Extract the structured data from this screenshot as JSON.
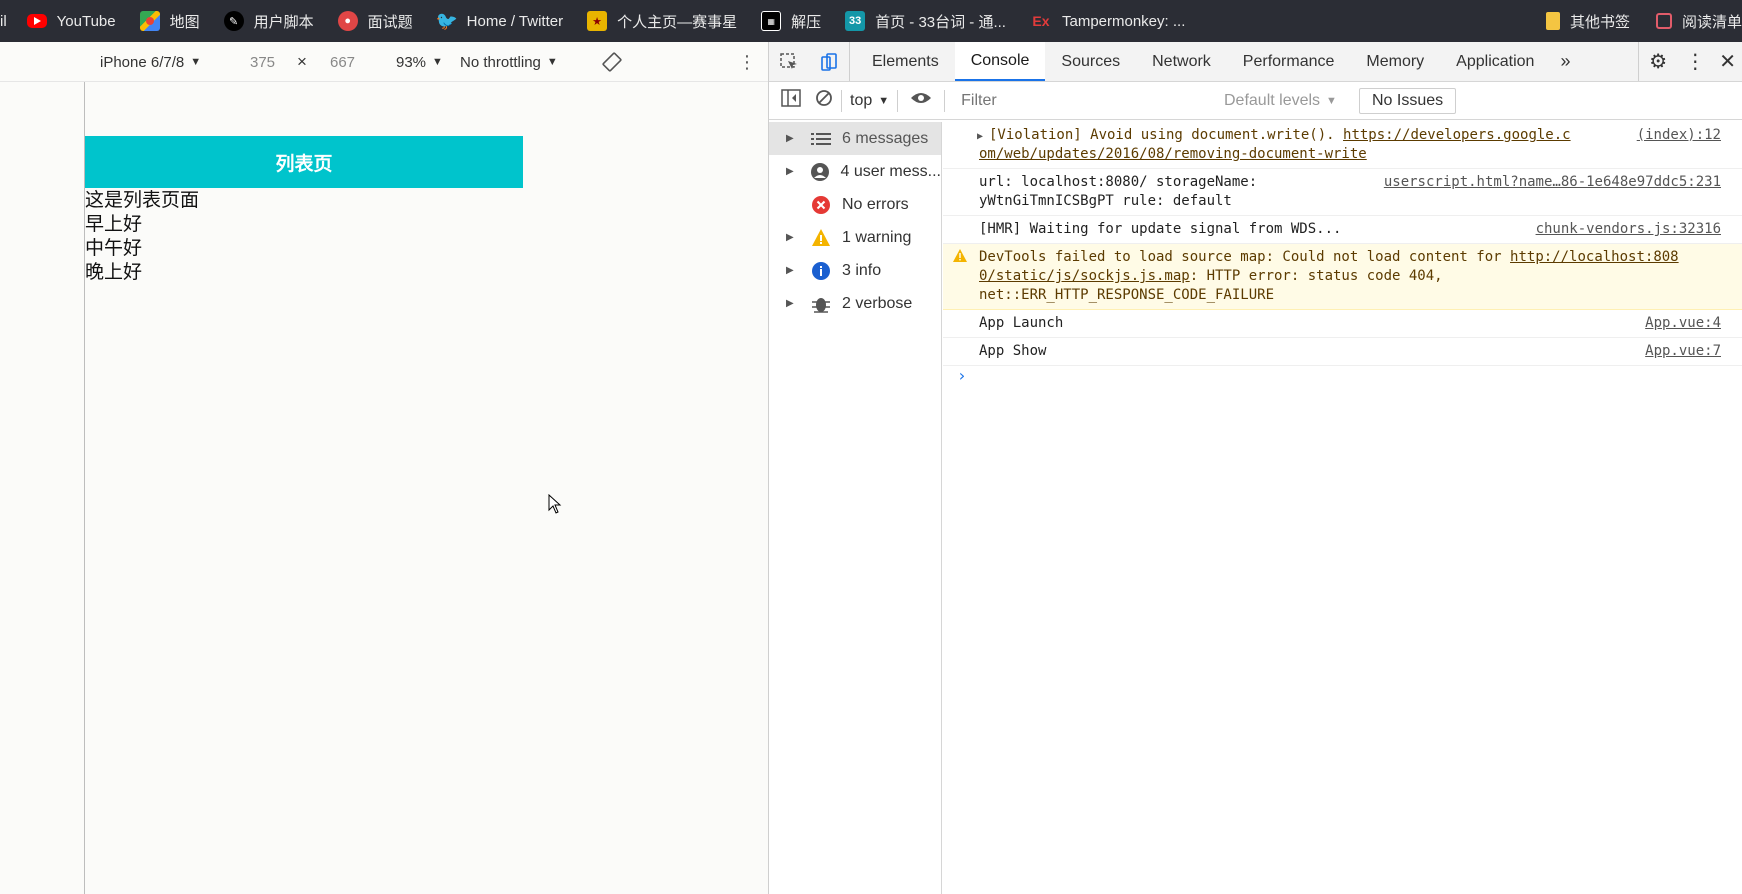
{
  "bookmarks": {
    "items": [
      {
        "label": "il"
      },
      {
        "label": "YouTube"
      },
      {
        "label": "地图"
      },
      {
        "label": "用户脚本"
      },
      {
        "label": "面试题"
      },
      {
        "label": "Home / Twitter"
      },
      {
        "label": "个人主页—赛事星"
      },
      {
        "label": "解压"
      },
      {
        "label": "首页 - 33台词 - 通..."
      },
      {
        "label": "Tampermonkey: ..."
      }
    ],
    "other": "其他书签",
    "reading_list": "阅读清单"
  },
  "device_toolbar": {
    "device": "iPhone 6/7/8",
    "width": "375",
    "times": "×",
    "height": "667",
    "zoom": "93%",
    "throttling": "No throttling"
  },
  "page": {
    "title": "列表页",
    "lines": [
      "这是列表页面",
      "早上好",
      "中午好",
      "晚上好"
    ]
  },
  "devtools": {
    "tabs": [
      "Elements",
      "Console",
      "Sources",
      "Network",
      "Performance",
      "Memory",
      "Application"
    ],
    "active_tab": "Console",
    "context": "top",
    "filter_placeholder": "Filter",
    "levels": "Default levels",
    "issues": "No Issues",
    "sidebar": [
      {
        "label": "6 messages",
        "icon": "list-icon"
      },
      {
        "label": "4 user mess...",
        "icon": "user-icon"
      },
      {
        "label": "No errors",
        "icon": "error-icon"
      },
      {
        "label": "1 warning",
        "icon": "warning-icon"
      },
      {
        "label": "3 info",
        "icon": "info-icon"
      },
      {
        "label": "2 verbose",
        "icon": "bug-icon"
      }
    ],
    "messages": {
      "violation_text": "[Violation] Avoid using document.write().",
      "violation_link": "https://developers.google.c",
      "violation_link_cont": "om/web/updates/2016/08/removing-document-write",
      "violation_src": "(index):12",
      "url_line1": "url: localhost:8080/ storageName:",
      "url_line2": "yWtnGiTmnICSBgPT rule: default",
      "url_src": "userscript.html?name…86-1e648e97ddc5:231",
      "hmr_text": "[HMR] Waiting for update signal from WDS...",
      "hmr_src": "chunk-vendors.js:32316",
      "warn_text": "DevTools failed to load source map: Could not load content for",
      "warn_link": "http://localhost:808",
      "warn_link_cont": "0/static/js/sockjs.js.map",
      "warn_text2": ": HTTP error: status code 404,",
      "warn_text3": "net::ERR_HTTP_RESPONSE_CODE_FAILURE",
      "launch_text": "App Launch",
      "launch_src": "App.vue:4",
      "show_text": "App Show",
      "show_src": "App.vue:7"
    }
  }
}
